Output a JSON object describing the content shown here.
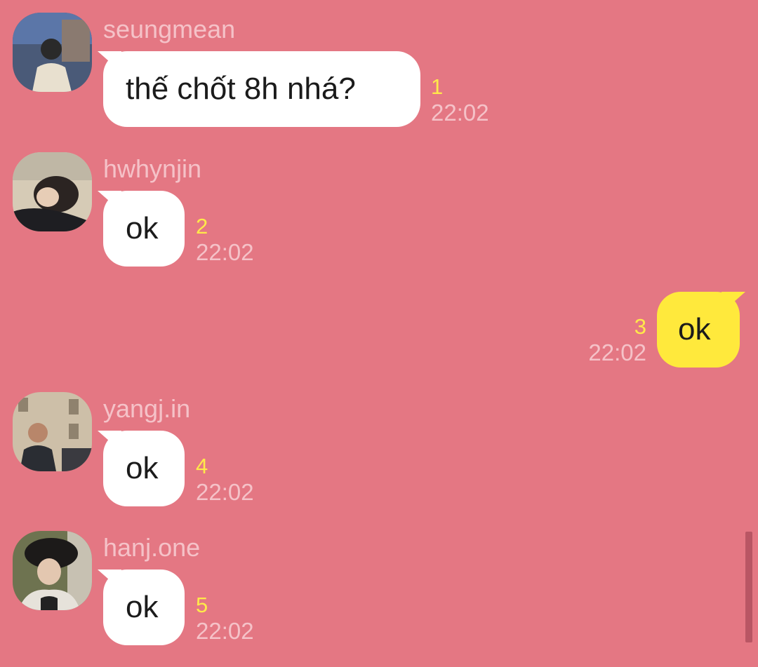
{
  "messages": [
    {
      "sender": "seungmean",
      "text": "thế chốt 8h nhá?",
      "unread": "1",
      "time": "22:02"
    },
    {
      "sender": "hwhynjin",
      "text": "ok",
      "unread": "2",
      "time": "22:02"
    },
    {
      "self": true,
      "text": "ok",
      "unread": "3",
      "time": "22:02"
    },
    {
      "sender": "yangj.in",
      "text": "ok",
      "unread": "4",
      "time": "22:02"
    },
    {
      "sender": "hanj.one",
      "text": "ok",
      "unread": "5",
      "time": "22:02"
    }
  ],
  "colors": {
    "background": "#E47783",
    "incoming_bubble": "#FFFFFF",
    "outgoing_bubble": "#FFE93C",
    "unread_count": "#FFE94A",
    "meta_text": "#F5C2C8"
  }
}
